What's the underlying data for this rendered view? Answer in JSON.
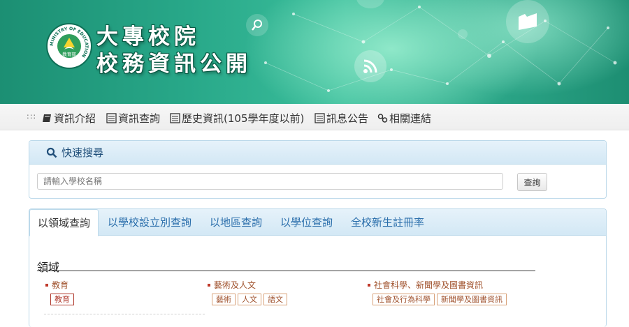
{
  "banner": {
    "title_line1": "大專校院",
    "title_line2": "校務資訊公開",
    "logo_ring_text": "MINISTRY OF EDUCATION",
    "logo_center_text": "教育部"
  },
  "nav": {
    "items": [
      {
        "label": "資訊介紹",
        "icon": "book-icon"
      },
      {
        "label": "資訊查詢",
        "icon": "list-icon"
      },
      {
        "label": "歷史資訊(105學年度以前)",
        "icon": "list-icon"
      },
      {
        "label": "訊息公告",
        "icon": "list-icon"
      },
      {
        "label": "相關連結",
        "icon": "link-icon"
      }
    ]
  },
  "search": {
    "heading": "快速搜尋",
    "placeholder": "請輸入學校名稱",
    "button_label": "查詢"
  },
  "tabs": {
    "items": [
      "以領域查詢",
      "以學校設立別查詢",
      "以地區查詢",
      "以學位查詢",
      "全校新生註冊率"
    ],
    "active_index": 0
  },
  "domain_section": {
    "title": "領域",
    "categories": [
      {
        "label": "教育",
        "tags": [
          "教育"
        ]
      },
      {
        "label": "藝術及人文",
        "tags": [
          "藝術",
          "人文",
          "語文"
        ]
      },
      {
        "label": "社會科學、新聞學及圖書資訊",
        "tags": [
          "社會及行為科學",
          "新聞學及圖書資訊"
        ]
      }
    ]
  },
  "colors": {
    "banner_green": "#2aa486",
    "link_blue": "#2a6eab",
    "category_brown": "#a0522d"
  }
}
